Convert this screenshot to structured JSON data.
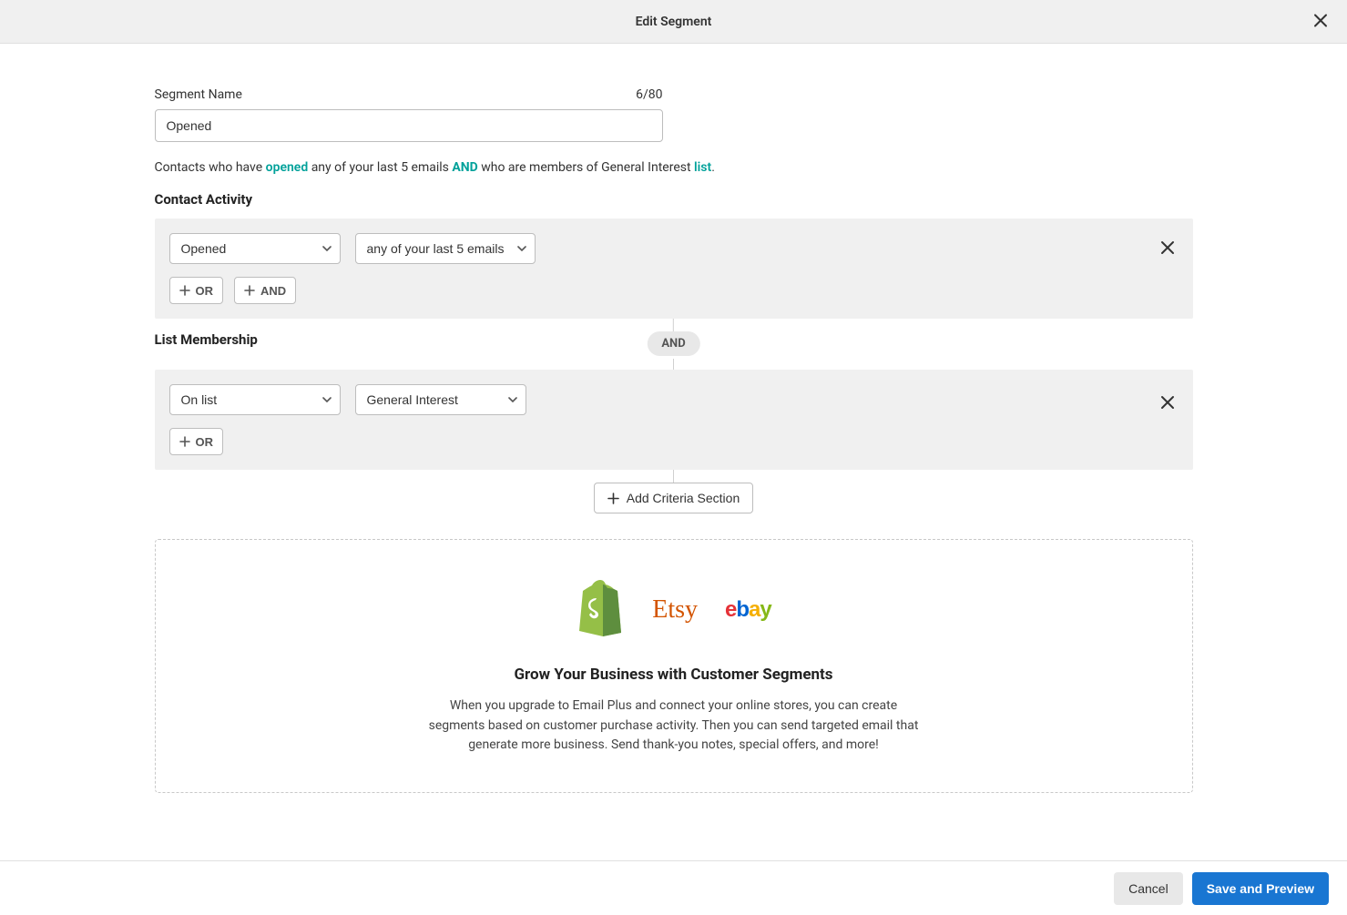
{
  "header": {
    "title": "Edit Segment"
  },
  "name_field": {
    "label": "Segment Name",
    "value": "Opened",
    "char_count": "6/80"
  },
  "summary": {
    "prefix": "Contacts who have ",
    "opened": "opened",
    "mid1": " any of your last 5 emails ",
    "and": "AND",
    "mid2": " who are members of General Interest ",
    "list": "list",
    "suffix": "."
  },
  "sections": {
    "contact_activity": {
      "title": "Contact Activity",
      "action_value": "Opened",
      "scope_value": "any of your last 5 emails"
    },
    "list_membership": {
      "title": "List Membership",
      "operator_value": "On list",
      "list_value": "General Interest"
    }
  },
  "connector": {
    "label": "AND"
  },
  "buttons": {
    "or": "OR",
    "and": "AND",
    "add_criteria": "Add Criteria Section",
    "cancel": "Cancel",
    "save": "Save and Preview"
  },
  "promo": {
    "title": "Grow Your Business with Customer Segments",
    "body": "When you upgrade to Email Plus and connect your online stores, you can create segments based on customer purchase activity. Then you can send targeted email that generate more business. Send thank-you notes, special offers, and more!",
    "logos": {
      "shopify": "shopify",
      "etsy": "Etsy",
      "ebay": "ebay"
    }
  }
}
